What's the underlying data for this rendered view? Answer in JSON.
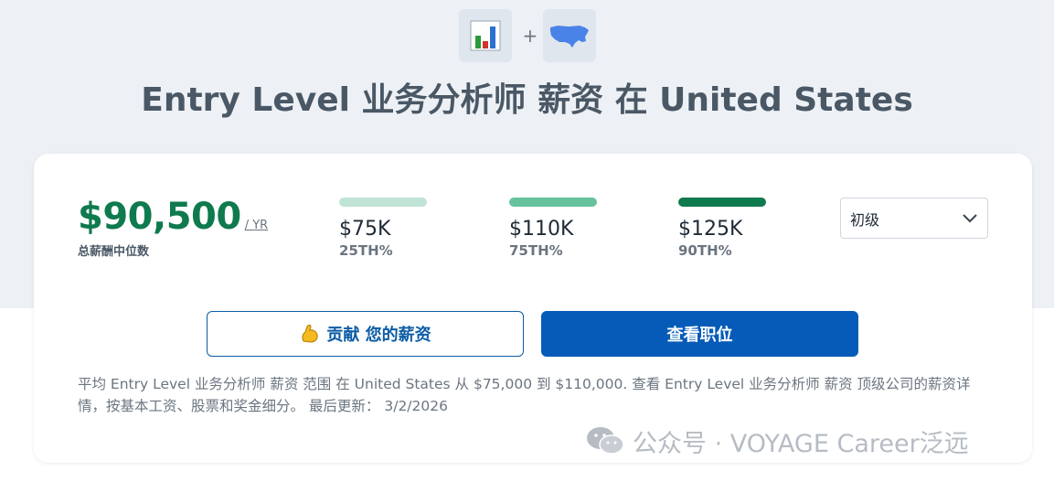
{
  "header": {
    "title": "Entry Level 业务分析师 薪资 在 United States",
    "icons": [
      "bar-chart-icon",
      "usa-map-icon"
    ],
    "plus": "+"
  },
  "salary": {
    "median": "$90,500",
    "median_unit": "/ YR",
    "median_label": "总薪酬中位数"
  },
  "percentiles": [
    {
      "value": "$75K",
      "label": "25TH%",
      "color": "#bfe3d4"
    },
    {
      "value": "$110K",
      "label": "75TH%",
      "color": "#66c29d"
    },
    {
      "value": "$125K",
      "label": "90TH%",
      "color": "#0f7a4d"
    }
  ],
  "level_select": {
    "value": "初级"
  },
  "buttons": {
    "contribute_label": "贡献 您的薪资",
    "view_jobs_label": "查看职位"
  },
  "summary_text": "平均 Entry Level 业务分析师 薪资 范围 在 United States 从 $75,000 到 $110,000. 查看 Entry Level 业务分析师 薪资 顶级公司的薪资详情，按基本工资、股票和奖金细分。 最后更新： 3/2/2026",
  "watermark": "公众号 · VOYAGE Career泛远",
  "colors": {
    "accent_green": "#0f7a4d",
    "primary_blue": "#055bb7",
    "band_bg": "#edf1f5"
  }
}
